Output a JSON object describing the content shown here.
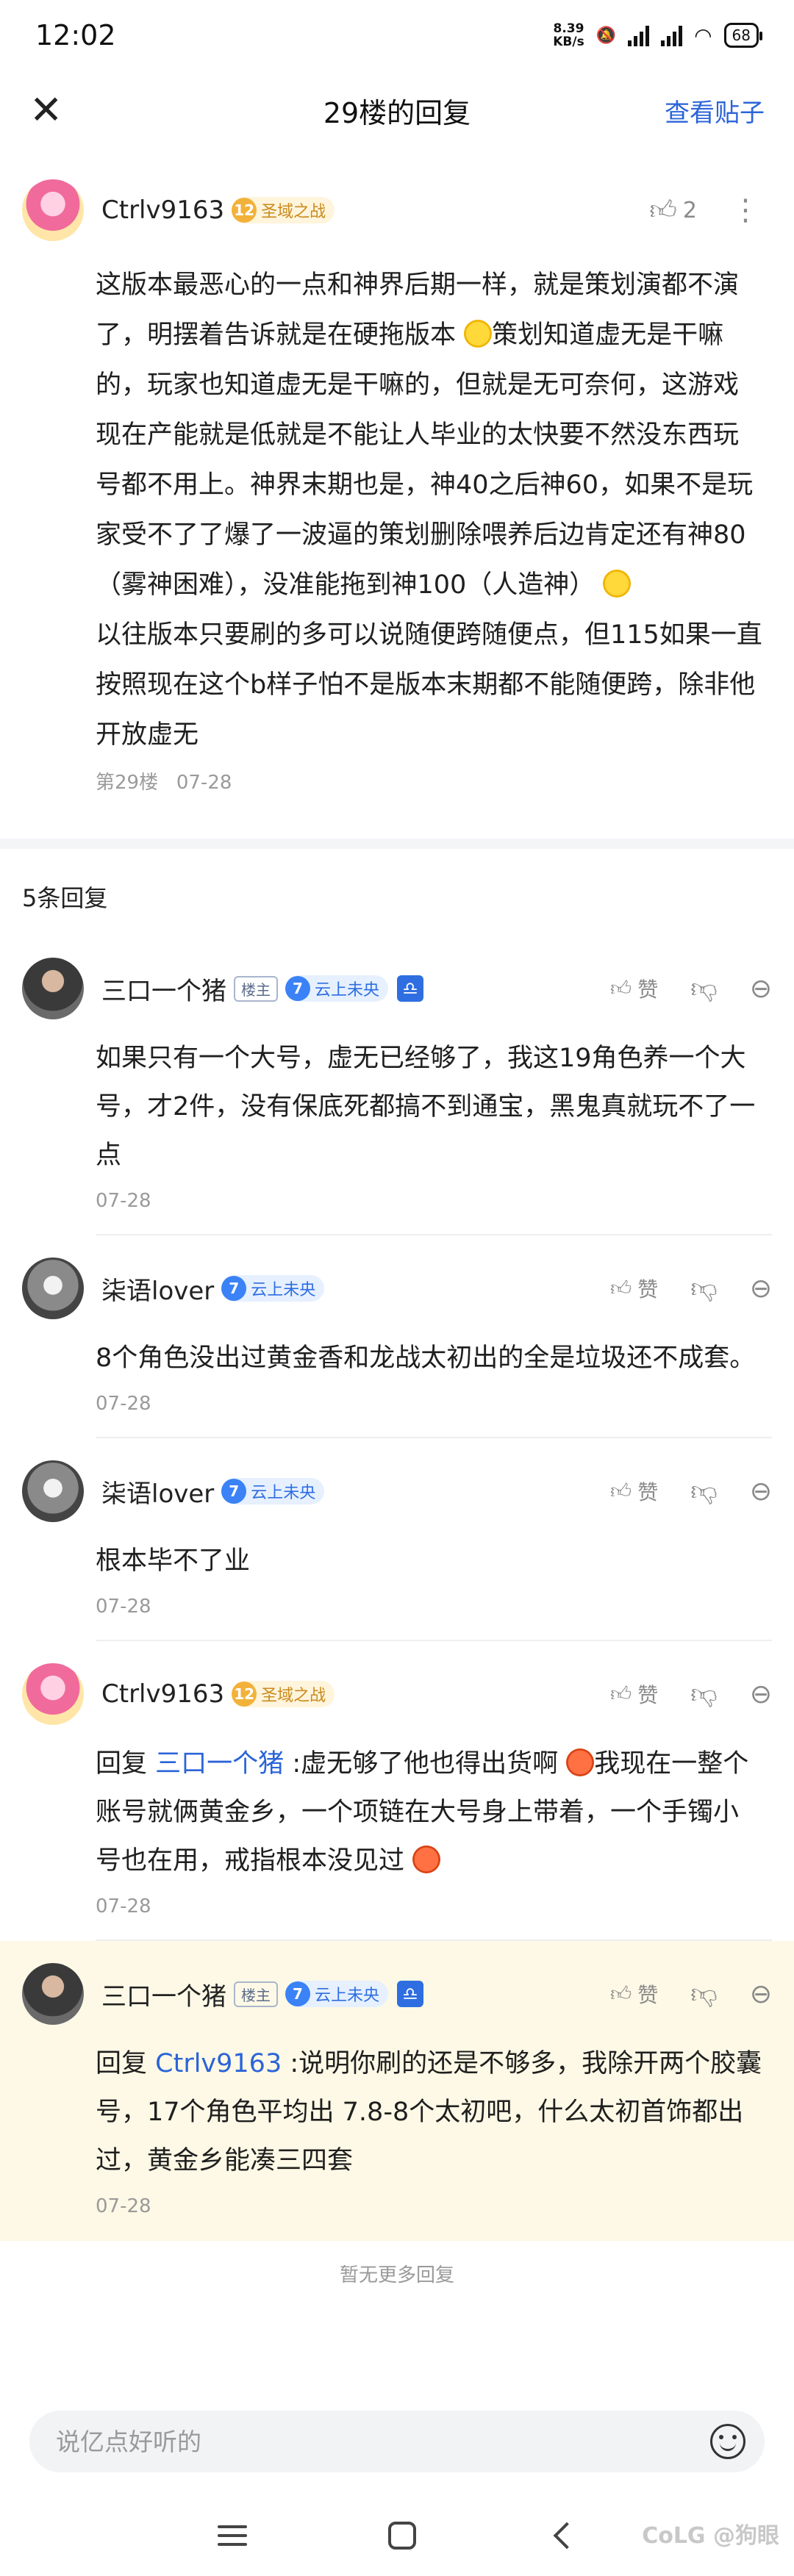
{
  "status": {
    "time": "12:02",
    "net_speed_value": "8.39",
    "net_speed_unit": "KB/s",
    "battery": "68"
  },
  "nav": {
    "title": "29楼的回复",
    "view_post": "查看贴子"
  },
  "main_post": {
    "username": "Ctrlv9163",
    "level": "12",
    "level_title": "圣域之战",
    "likes": "2",
    "paragraph1_a": "这版本最恶心的一点和神界后期一样，就是策划演都不演了，明摆着告诉就是在硬拖版本",
    "paragraph1_b": "策划知道虚无是干嘛的，玩家也知道虚无是干嘛的，但就是无可奈何，这游戏现在产能就是低就是不能让人毕业的太快要不然没东西玩号都不用上。神界末期也是，神40之后神60，如果不是玩家受不了了爆了一波逼的策划删除喂养后边肯定还有神80（雾神困难），没准能拖到神100（人造神）",
    "paragraph2": "以往版本只要刷的多可以说随便跨随便点，但115如果一直按照现在这个b样子怕不是版本末期都不能随便跨，除非他开放虚无",
    "floor": "第29楼",
    "date": "07-28"
  },
  "reply_count": "5条回复",
  "replies": [
    {
      "username": "三口一个猪",
      "host_tag": "楼主",
      "level": "7",
      "level_title": "云上未央",
      "badge": "♎",
      "like_label": "赞",
      "text": "如果只有一个大号，虚无已经够了，我这19角色养一个大号，才2件，没有保底死都搞不到通宝，黑鬼真就玩不了一点",
      "date": "07-28"
    },
    {
      "username": "柒语lover",
      "level": "7",
      "level_title": "云上未央",
      "like_label": "赞",
      "text": "8个角色没出过黄金香和龙战太初出的全是垃圾还不成套。",
      "date": "07-28"
    },
    {
      "username": "柒语lover",
      "level": "7",
      "level_title": "云上未央",
      "like_label": "赞",
      "text": "根本毕不了业",
      "date": "07-28"
    },
    {
      "username": "Ctrlv9163",
      "level": "12",
      "level_title": "圣域之战",
      "like_label": "赞",
      "reply_prefix": "回复",
      "mention": "三口一个猪",
      "text_a": ":虚无够了他也得出货啊",
      "text_b": "我现在一整个账号就俩黄金乡，一个项链在大号身上带着，一个手镯小号也在用，戒指根本没见过",
      "date": "07-28"
    },
    {
      "username": "三口一个猪",
      "host_tag": "楼主",
      "level": "7",
      "level_title": "云上未央",
      "badge": "♎",
      "like_label": "赞",
      "reply_prefix": "回复",
      "mention": "Ctrlv9163",
      "text": ":说明你刷的还是不够多，我除开两个胶囊号，17个角色平均出 7.8-8个太初吧，什么太初首饰都出过，黄金乡能凑三四套",
      "date": "07-28"
    }
  ],
  "no_more": "暂无更多回复",
  "input": {
    "placeholder": "说亿点好听的"
  },
  "watermark": "CoLG @狗眼"
}
